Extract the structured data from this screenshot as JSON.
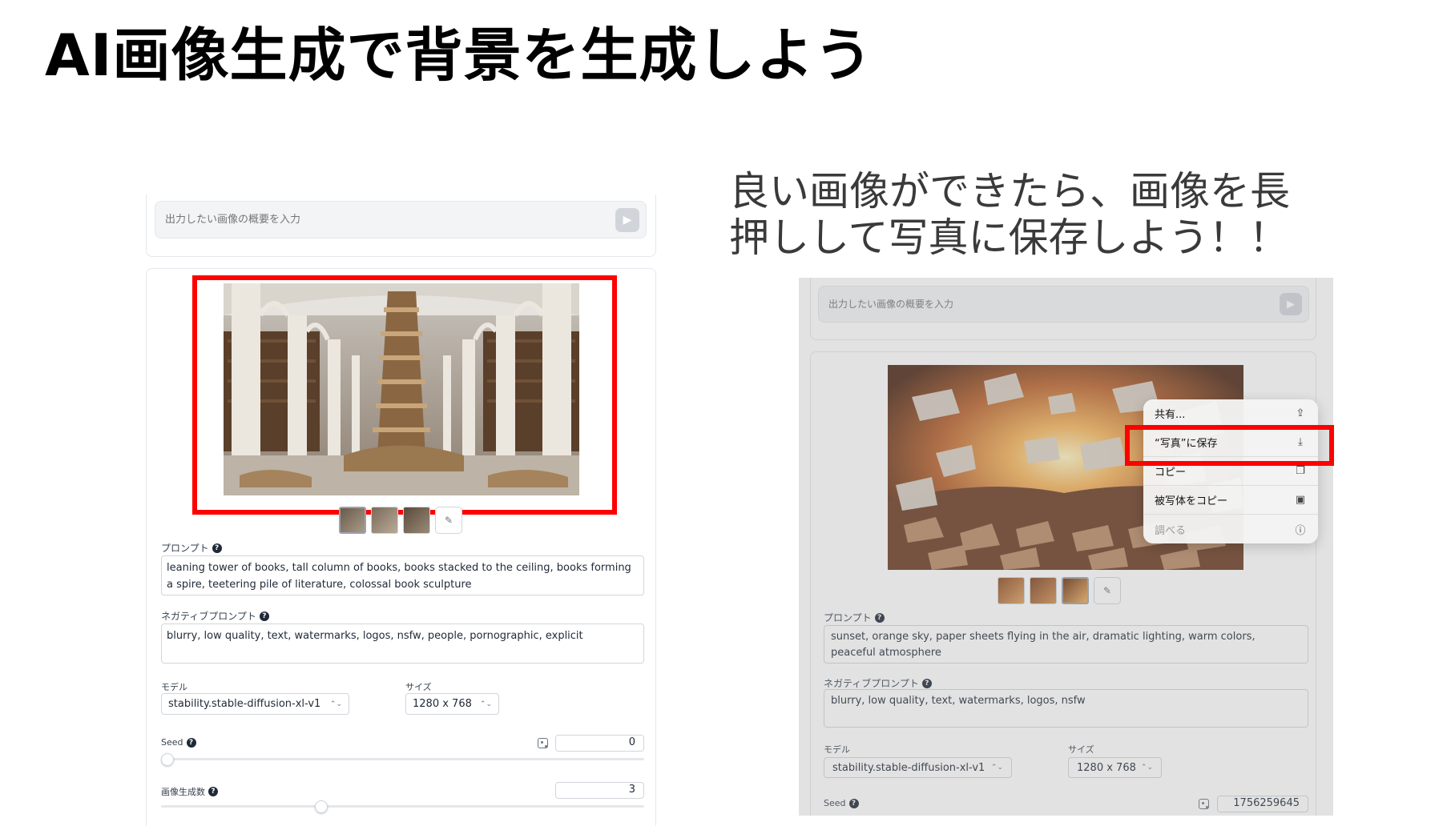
{
  "slide": {
    "title": "AI画像生成で背景を生成しよう",
    "subtitle_line1": "良い画像ができたら、画像を長",
    "subtitle_line2": "押しして写真に保存しよう！！"
  },
  "colors": {
    "highlight": "#ff0000",
    "accent": "#1f2937"
  },
  "left": {
    "prompt_placeholder": "出力したい画像の概要を入力",
    "prompt_label": "プロンプト",
    "prompt_value": "leaning tower of books, tall column of books, books stacked to the ceiling, books forming a spire, teetering pile of literature, colossal book sculpture",
    "negative_label": "ネガティブプロンプト",
    "negative_value": "blurry, low quality, text, watermarks, logos, nsfw, people, pornographic, explicit",
    "model_label": "モデル",
    "model_value": "stability.stable-diffusion-xl-v1",
    "size_label": "サイズ",
    "size_value": "1280 x 768",
    "seed_label": "Seed",
    "seed_value": "0",
    "count_label": "画像生成数",
    "count_value": "3",
    "count_slider": 0.33
  },
  "right": {
    "prompt_placeholder": "出力したい画像の概要を入力",
    "prompt_label": "プロンプト",
    "prompt_value": "sunset, orange sky, paper sheets flying in the air, dramatic lighting, warm colors, peaceful atmosphere",
    "negative_label": "ネガティブプロンプト",
    "negative_value": "blurry, low quality, text, watermarks, logos, nsfw",
    "model_label": "モデル",
    "model_value": "stability.stable-diffusion-xl-v1",
    "size_label": "サイズ",
    "size_value": "1280 x 768",
    "seed_label": "Seed",
    "seed_value": "1756259645",
    "menu": [
      {
        "label": "共有...",
        "icon": "share-icon"
      },
      {
        "label": "“写真”に保存",
        "icon": "save-photo-icon"
      },
      {
        "label": "コピー",
        "icon": "copy-icon"
      },
      {
        "label": "被写体をコピー",
        "icon": "subject-icon"
      },
      {
        "label": "調べる",
        "icon": "lookup-icon"
      }
    ]
  }
}
